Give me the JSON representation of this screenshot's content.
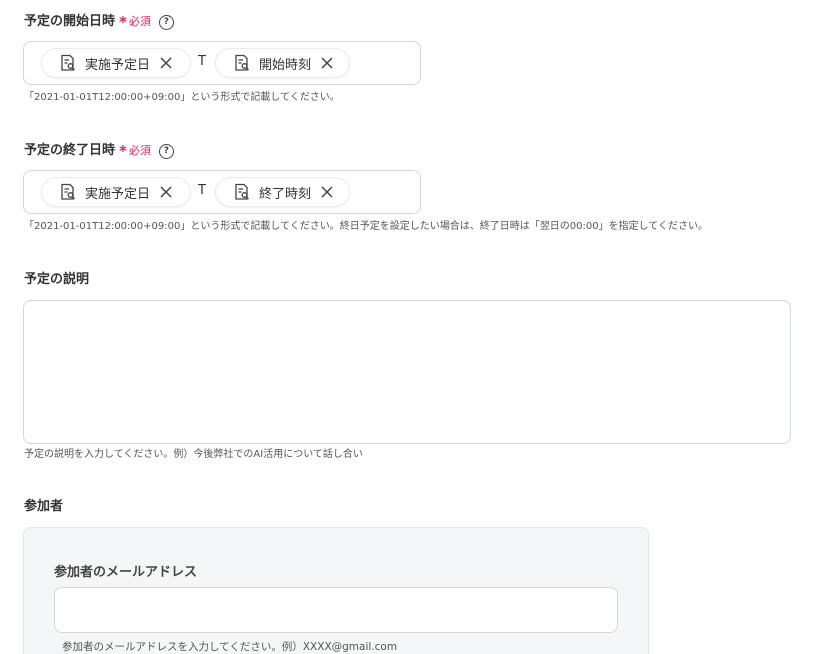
{
  "start": {
    "label": "予定の開始日時",
    "required_text": "必須",
    "help": "?",
    "chips": [
      {
        "label": "実施予定日",
        "icon": "document-search-icon"
      },
      {
        "label": "開始時刻",
        "icon": "document-search-icon"
      }
    ],
    "separator": "T",
    "hint": "「2021-01-01T12:00:00+09:00」という形式で記載してください。"
  },
  "end": {
    "label": "予定の終了日時",
    "required_text": "必須",
    "help": "?",
    "chips": [
      {
        "label": "実施予定日",
        "icon": "document-search-icon"
      },
      {
        "label": "終了時刻",
        "icon": "document-search-icon"
      }
    ],
    "separator": "T",
    "hint": "「2021-01-01T12:00:00+09:00」という形式で記載してください。終日予定を設定したい場合は、終了日時は「翌日の00:00」を指定してください。"
  },
  "description": {
    "label": "予定の説明",
    "value": "",
    "hint": "予定の説明を入力してください。例）今後弊社でのAI活用について話し合い"
  },
  "participants": {
    "label": "参加者",
    "email_label": "参加者のメールアドレス",
    "email_value": "",
    "email_hint": "参加者のメールアドレスを入力してください。例）XXXX@gmail.com"
  },
  "colors": {
    "required": "#e0245e",
    "border": "#d3d6db",
    "panel_bg": "#f5f6f8",
    "text": "#333333"
  }
}
